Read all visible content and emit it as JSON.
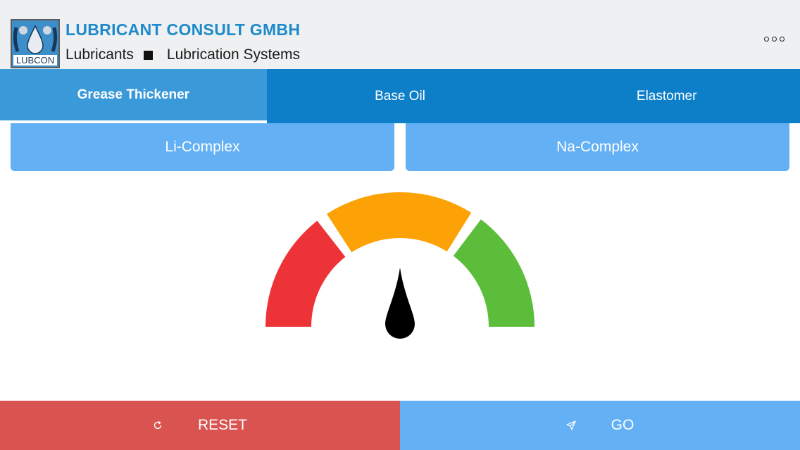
{
  "header": {
    "company_name": "LUBRICANT CONSULT GMBH",
    "tagline_left": "Lubricants",
    "tagline_right": "Lubrication Systems",
    "logo_text": "LUBCON",
    "menu_icon": "more-horizontal-icon"
  },
  "tabs": [
    {
      "label": "Grease Thickener",
      "active": true
    },
    {
      "label": "Base Oil",
      "active": false
    },
    {
      "label": "Elastomer",
      "active": false
    }
  ],
  "options": [
    {
      "label": "Li-Complex"
    },
    {
      "label": "Na-Complex"
    }
  ],
  "gauge": {
    "segments": [
      {
        "color": "#ee3338",
        "meaning": "red"
      },
      {
        "color": "#fca206",
        "meaning": "orange"
      },
      {
        "color": "#5bbd39",
        "meaning": "green"
      }
    ],
    "needle_value": 0.5,
    "needle_color": "#000000"
  },
  "footer": {
    "reset_label": "RESET",
    "reset_icon": "refresh-icon",
    "go_label": "GO",
    "go_icon": "send-icon"
  },
  "colors": {
    "header_bg": "#eef0f2",
    "brand_blue": "#1d8acb",
    "tab_bar": "#0d7fc9",
    "tab_active": "#3a99d8",
    "option_button": "#64b0f5",
    "reset_button": "#d95350",
    "go_button": "#64b0f5"
  }
}
